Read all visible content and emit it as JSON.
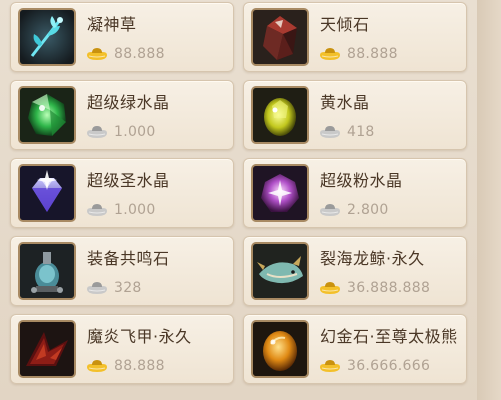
{
  "items": [
    {
      "name": "凝神草",
      "price": "88.888",
      "currency": "gold",
      "icon": "herb-icon"
    },
    {
      "name": "天倾石",
      "price": "88.888",
      "currency": "gold",
      "icon": "dark-stone-icon"
    },
    {
      "name": "超级绿水晶",
      "price": "1.000",
      "currency": "silver",
      "icon": "green-crystal-icon"
    },
    {
      "name": "黄水晶",
      "price": "418",
      "currency": "silver",
      "icon": "yellow-crystal-icon"
    },
    {
      "name": "超级圣水晶",
      "price": "1.000",
      "currency": "silver",
      "icon": "holy-crystal-icon"
    },
    {
      "name": "超级粉水晶",
      "price": "2.800",
      "currency": "silver",
      "icon": "pink-crystal-icon"
    },
    {
      "name": "装备共鸣石",
      "price": "328",
      "currency": "silver",
      "icon": "resonance-stone-icon"
    },
    {
      "name": "裂海龙鲸·永久",
      "price": "36.888.888",
      "currency": "gold",
      "icon": "dragon-whale-icon"
    },
    {
      "name": "魔炎飞甲·永久",
      "price": "88.888",
      "currency": "gold",
      "icon": "flame-wings-icon"
    },
    {
      "name": "幻金石·至尊太极熊",
      "price": "36.666.666",
      "currency": "gold",
      "icon": "amber-stone-icon"
    }
  ],
  "colors": {
    "gold": "#f3c02a",
    "silver": "#c9c9c9",
    "card_bg": "#f4ecdf",
    "name_text": "#4a3726",
    "price_text": "#b0a293"
  }
}
